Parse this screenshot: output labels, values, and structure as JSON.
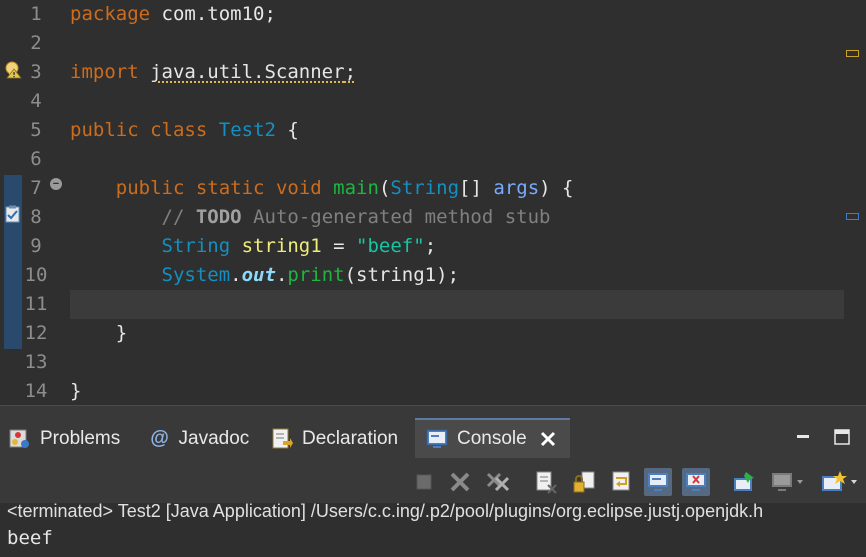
{
  "editor": {
    "line_numbers": [
      "1",
      "2",
      "3",
      "4",
      "5",
      "6",
      "7",
      "8",
      "9",
      "10",
      "11",
      "12",
      "13",
      "14"
    ],
    "tokens": {
      "kw_package": "package",
      "pkg_name": "com.tom10",
      "semi": ";",
      "kw_import": "import",
      "import_path": "java.util.Scanner",
      "kw_public": "public",
      "kw_class": "class",
      "class_name": "Test2",
      "brace_open": "{",
      "brace_close": "}",
      "kw_static": "static",
      "kw_void": "void",
      "method_main": "main",
      "paren_open": "(",
      "type_string": "String",
      "array_suffix": "[]",
      "param_args": "args",
      "paren_close_brace": ") {",
      "comment_slash": "//",
      "todo_tag": "TODO",
      "comment_text": "Auto-generated method stub",
      "var_string1": "string1",
      "assign": "=",
      "string_literal": "\"beef\"",
      "system": "System",
      "dot": ".",
      "field_out": "out",
      "method_print": "print",
      "call_end": ");"
    }
  },
  "panel": {
    "tabs": [
      {
        "label": "Problems",
        "active": false
      },
      {
        "label": "Javadoc",
        "active": false
      },
      {
        "label": "Declaration",
        "active": false
      },
      {
        "label": "Console",
        "active": true
      }
    ],
    "javadoc_symbol": "@",
    "status_line": "<terminated> Test2 [Java Application] /Users/c.c.ing/.p2/pool/plugins/org.eclipse.justj.openjdk.h",
    "output": "beef"
  },
  "colors": {
    "editor_bg": "#2f2f2f",
    "keyword": "#cc6c1d",
    "class": "#1290c3",
    "variable": "#f3ec79",
    "string": "#17c6a3",
    "method": "#1eb540",
    "active_tab_accent": "#5c7ca6"
  }
}
